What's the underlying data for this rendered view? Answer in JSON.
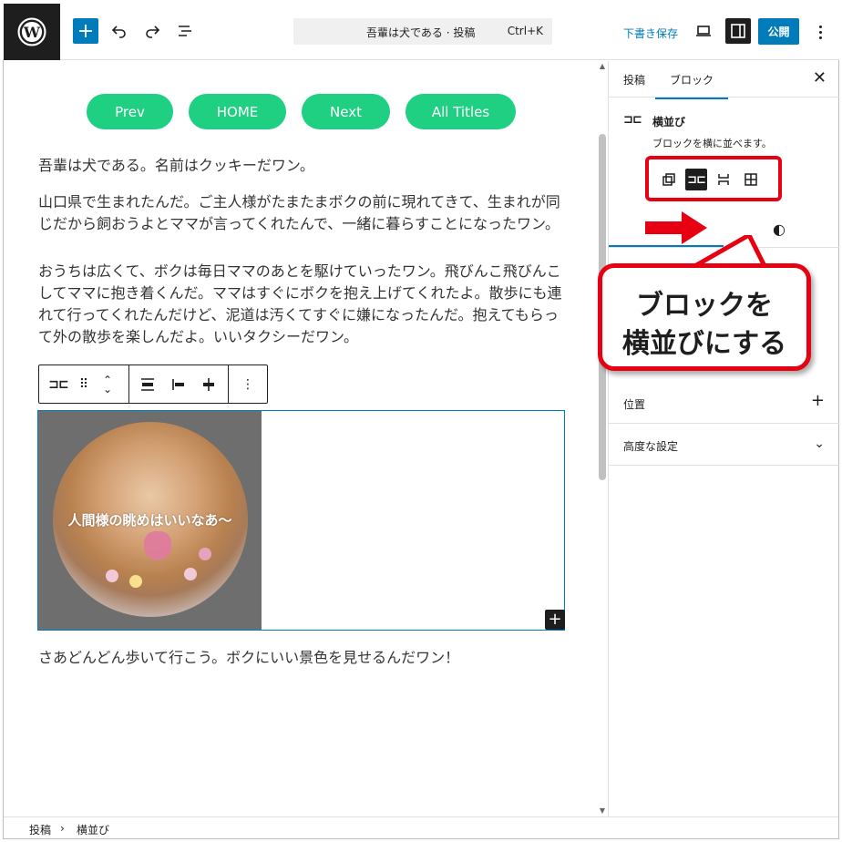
{
  "topbar": {
    "command_title": "吾輩は犬である · 投稿",
    "shortcut": "Ctrl+K",
    "save_draft": "下書き保存",
    "publish": "公開"
  },
  "content": {
    "nav_buttons": [
      "Prev",
      "HOME",
      "Next",
      "All Titles"
    ],
    "paragraphs": [
      "吾輩は犬である。名前はクッキーだワン。",
      "山口県で生まれたんだ。ご主人様がたまたまボクの前に現れてきて、生まれが同じだから飼おうよとママが言ってくれたんで、一緒に暮らすことになったワン。",
      "おうちは広くて、ボクは毎日ママのあとを駆けていったワン。飛びんこ飛びんこしてママに抱き着くんだ。ママはすぐにボクを抱え上げてくれたよ。散歩にも連れて行ってくれたんだけど、泥道は汚くてすぐに嫌になったんだ。抱えてもらって外の散歩を楽しんだよ。いいタクシーだワン。",
      "さあどんどん歩いて行こう。ボクにいい景色を見せるんだワン！"
    ],
    "cover_caption": "人間様の眺めはいいなあ〜"
  },
  "sidebar": {
    "tabs": [
      "投稿",
      "ブロック"
    ],
    "block_title": "横並び",
    "block_description": "ブロックを横に並べます。",
    "panels": [
      "位置",
      "高度な設定"
    ]
  },
  "annotation": {
    "line1": "ブロックを",
    "line2": "横並びにする",
    "color": "#e60012"
  },
  "footer": {
    "crumbs": [
      "投稿",
      "横並び"
    ]
  },
  "colors": {
    "accent": "#007cba",
    "button_green": "#1fd083"
  }
}
